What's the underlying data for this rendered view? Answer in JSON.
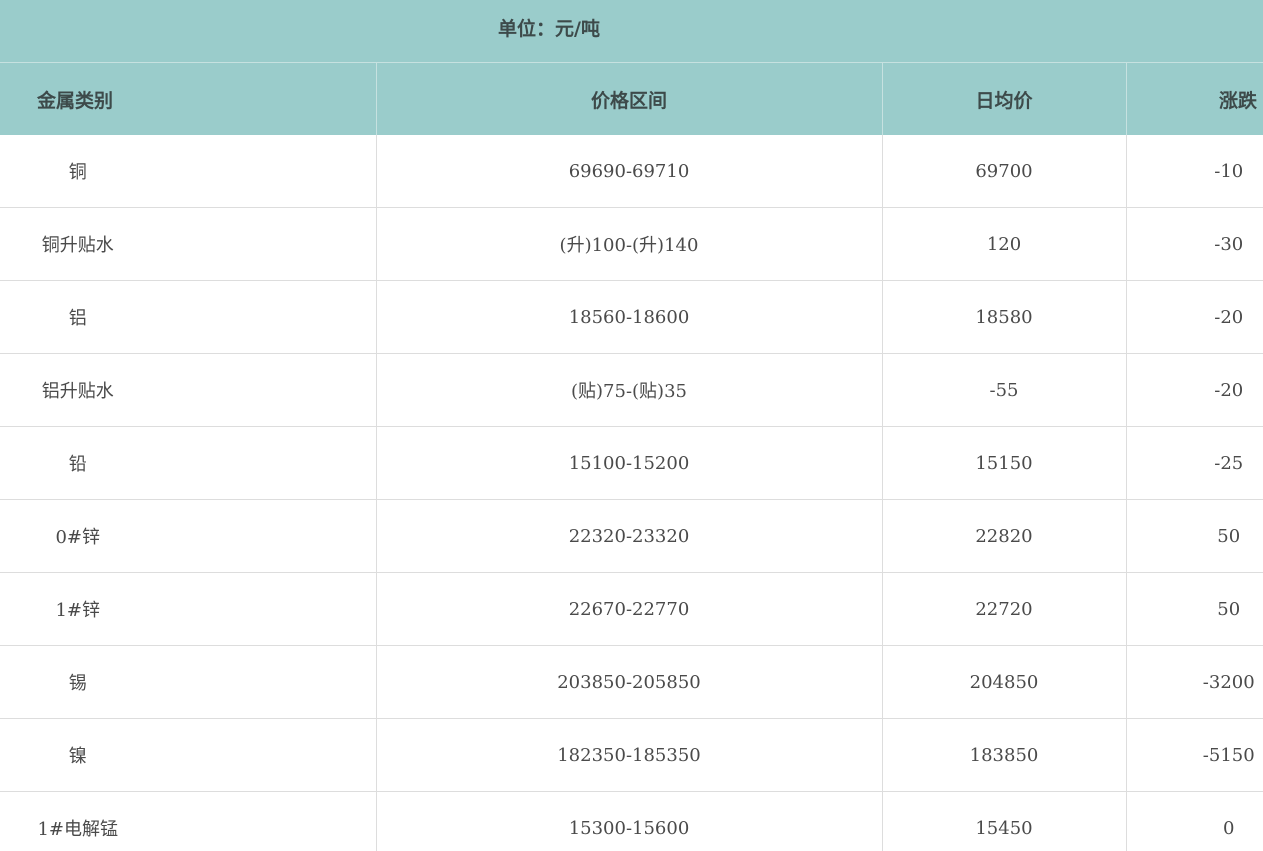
{
  "unit_label": "单位：元/吨",
  "headers": {
    "name": "金属类别",
    "range": "价格区间",
    "avg": "日均价",
    "change": "涨跌"
  },
  "rows": [
    {
      "name": "铜",
      "range": "69690-69710",
      "avg": "69700",
      "change": "-10"
    },
    {
      "name": "铜升贴水",
      "range": "(升)100-(升)140",
      "avg": "120",
      "change": "-30"
    },
    {
      "name": "铝",
      "range": "18560-18600",
      "avg": "18580",
      "change": "-20"
    },
    {
      "name": "铝升贴水",
      "range": "(贴)75-(贴)35",
      "avg": "-55",
      "change": "-20"
    },
    {
      "name": "铅",
      "range": "15100-15200",
      "avg": "15150",
      "change": "-25"
    },
    {
      "name": "0#锌",
      "range": "22320-23320",
      "avg": "22820",
      "change": "50"
    },
    {
      "name": "1#锌",
      "range": "22670-22770",
      "avg": "22720",
      "change": "50"
    },
    {
      "name": "锡",
      "range": "203850-205850",
      "avg": "204850",
      "change": "-3200"
    },
    {
      "name": "镍",
      "range": "182350-185350",
      "avg": "183850",
      "change": "-5150"
    },
    {
      "name": "1#电解锰",
      "range": "15300-15600",
      "avg": "15450",
      "change": "0"
    }
  ],
  "colors": {
    "header_bg": "#9acccb",
    "grid_line": "#dddddd"
  }
}
